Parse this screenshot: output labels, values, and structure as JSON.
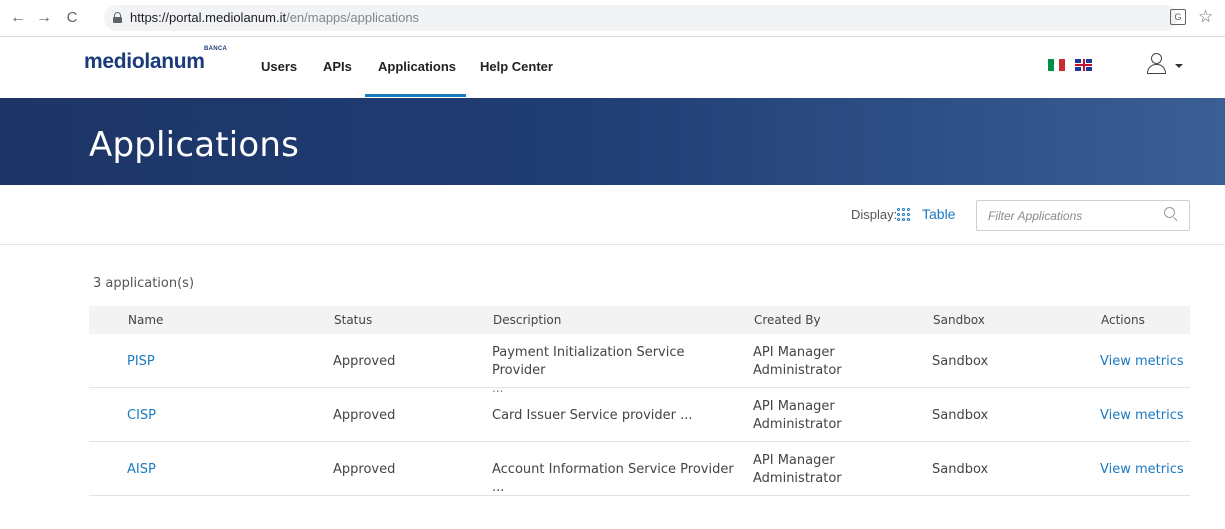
{
  "browser": {
    "url_host": "https://portal.mediolanum.it",
    "url_path": "/en/mapps/applications",
    "back_glyph": "←",
    "forward_glyph": "→",
    "reload_glyph": "C",
    "star_glyph": "☆",
    "translate_glyph": "G"
  },
  "nav": {
    "logo_text": "mediolanum",
    "logo_banca": "BANCA",
    "items": [
      {
        "label": "Users"
      },
      {
        "label": "APIs"
      },
      {
        "label": "Applications",
        "active": true
      },
      {
        "label": "Help Center"
      }
    ]
  },
  "banner": {
    "title": "Applications"
  },
  "toolbar": {
    "display_label": "Display:",
    "display_value": "Table",
    "filter_placeholder": "Filter Applications"
  },
  "list": {
    "count_text": "3 application(s)",
    "columns": [
      "Name",
      "Status",
      "Description",
      "Created By",
      "Sandbox",
      "Actions"
    ],
    "rows": [
      {
        "name": "PISP",
        "status": "Approved",
        "description": "Payment Initialization Service Provider",
        "description_more": "...",
        "created_by": "API Manager Administrator",
        "sandbox": "Sandbox",
        "action": "View metrics"
      },
      {
        "name": "CISP",
        "status": "Approved",
        "description": "Card Issuer Service provider ...",
        "created_by": "API Manager Administrator",
        "sandbox": "Sandbox",
        "action": "View metrics"
      },
      {
        "name": "AISP",
        "status": "Approved",
        "description": "Account Information Service Provider ...",
        "created_by": "API Manager Administrator",
        "sandbox": "Sandbox",
        "action": "View metrics"
      }
    ]
  },
  "colors": {
    "accent": "#1a7ac0",
    "brand": "#1a3a7a",
    "banner_start": "#1d3566",
    "banner_end": "#3a5f95"
  }
}
